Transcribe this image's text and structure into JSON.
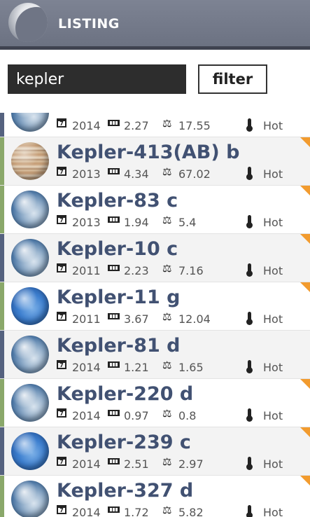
{
  "header": {
    "title": "LISTING"
  },
  "search": {
    "value": "kepler",
    "button_label": "filter"
  },
  "colors": {
    "header_bg": "#747a8a",
    "name_text": "#415172",
    "corner_badge": "#f29b2e",
    "stripe_blue": "#55627f",
    "stripe_green": "#8aa86a"
  },
  "planets": [
    {
      "name": "",
      "year": "2014",
      "radius": "2.27",
      "mass": "17.55",
      "temperature": "Hot",
      "image": "earth-like",
      "stripe": "blue",
      "badge": false
    },
    {
      "name": "Kepler-413(AB) b",
      "year": "2013",
      "radius": "4.34",
      "mass": "67.02",
      "temperature": "Hot",
      "image": "jupiter-like",
      "stripe": "green",
      "badge": true
    },
    {
      "name": "Kepler-83 c",
      "year": "2013",
      "radius": "1.94",
      "mass": "5.4",
      "temperature": "Hot",
      "image": "earth-like",
      "stripe": "green",
      "badge": true
    },
    {
      "name": "Kepler-10 c",
      "year": "2011",
      "radius": "2.23",
      "mass": "7.16",
      "temperature": "Hot",
      "image": "earth-like",
      "stripe": "blue",
      "badge": true
    },
    {
      "name": "Kepler-11 g",
      "year": "2011",
      "radius": "3.67",
      "mass": "12.04",
      "temperature": "Hot",
      "image": "neptune-like",
      "stripe": "green",
      "badge": true
    },
    {
      "name": "Kepler-81 d",
      "year": "2014",
      "radius": "1.21",
      "mass": "1.65",
      "temperature": "Hot",
      "image": "earth-like",
      "stripe": "blue",
      "badge": false
    },
    {
      "name": "Kepler-220 d",
      "year": "2014",
      "radius": "0.97",
      "mass": "0.8",
      "temperature": "Hot",
      "image": "earth-like",
      "stripe": "green",
      "badge": true
    },
    {
      "name": "Kepler-239 c",
      "year": "2014",
      "radius": "2.51",
      "mass": "2.97",
      "temperature": "Hot",
      "image": "neptune-like",
      "stripe": "blue",
      "badge": true
    },
    {
      "name": "Kepler-327 d",
      "year": "2014",
      "radius": "1.72",
      "mass": "5.82",
      "temperature": "Hot",
      "image": "earth-like",
      "stripe": "green",
      "badge": true
    }
  ]
}
